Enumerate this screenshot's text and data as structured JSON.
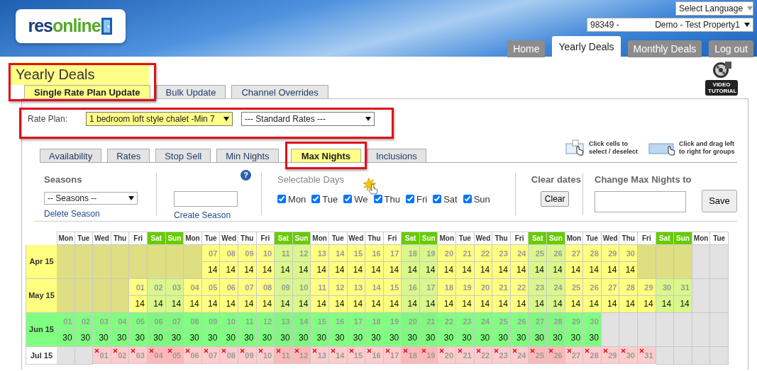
{
  "logo": {
    "parts": [
      {
        "text": "res",
        "color": "#1b3f7a"
      },
      {
        "text": "online",
        "color": "#56a92b"
      }
    ]
  },
  "language_select": "Select Language",
  "property_select": {
    "code": "98349 -",
    "name": "Demo - Test Property1"
  },
  "nav": [
    {
      "label": "Home",
      "selected": false
    },
    {
      "label": "Yearly Deals",
      "selected": true
    },
    {
      "label": "Monthly Deals",
      "selected": false
    },
    {
      "label": "Log out",
      "selected": false
    }
  ],
  "page_title": {
    "text": "Yearly Deals",
    "highlighted": true
  },
  "video_tutorial": "VIDEO TUTORIAL",
  "subtabs": [
    {
      "label": "Single Rate Plan Update",
      "selected": true,
      "highlighted": true
    },
    {
      "label": "Bulk Update",
      "selected": false,
      "highlighted": false
    },
    {
      "label": "Channel Overrides",
      "selected": false,
      "highlighted": false
    }
  ],
  "rate_plan": {
    "label": "Rate Plan:",
    "highlighted": true,
    "selects": [
      {
        "value": "1 bedroom loft style chalet -Min 7",
        "highlighted": true
      },
      {
        "value": "--- Standard Rates ---",
        "highlighted": false
      }
    ]
  },
  "hints": [
    "Click cells to select / deselect",
    "Click and drag left to right for groups"
  ],
  "tabs": [
    {
      "label": "Availability",
      "selected": false,
      "highlighted": false
    },
    {
      "label": "Rates",
      "selected": false,
      "highlighted": false
    },
    {
      "label": "Stop Sell",
      "selected": false,
      "highlighted": false
    },
    {
      "label": "Min Nights",
      "selected": false,
      "highlighted": false
    },
    {
      "label": "Max Nights",
      "selected": true,
      "highlighted": true
    },
    {
      "label": "Inclusions",
      "selected": false,
      "highlighted": false
    }
  ],
  "seasons": {
    "heading": "Seasons",
    "help": "?",
    "select": "-- Seasons --",
    "delete_link": "Delete Season",
    "create_link": "Create Season"
  },
  "selectable_days": {
    "heading": "Selectable Days",
    "days": [
      {
        "label": "Mon",
        "checked": true
      },
      {
        "label": "Tue",
        "checked": true
      },
      {
        "label": "We",
        "checked": true
      },
      {
        "label": "Thu",
        "checked": true
      },
      {
        "label": "Fri",
        "checked": true
      },
      {
        "label": "Sat",
        "checked": true
      },
      {
        "label": "Sun",
        "checked": true
      }
    ]
  },
  "clear_dates": {
    "heading": "Clear dates",
    "button": "Clear"
  },
  "change_max": {
    "heading": "Change Max Nights to",
    "button": "Save"
  },
  "calendar": {
    "columns": [
      {
        "label": "Mon",
        "weekend": false
      },
      {
        "label": "Tue",
        "weekend": false
      },
      {
        "label": "Wed",
        "weekend": false
      },
      {
        "label": "Thu",
        "weekend": false
      },
      {
        "label": "Fri",
        "weekend": false
      },
      {
        "label": "Sat",
        "weekend": true
      },
      {
        "label": "Sun",
        "weekend": true
      },
      {
        "label": "Mon",
        "weekend": false
      },
      {
        "label": "Tue",
        "weekend": false
      },
      {
        "label": "Wed",
        "weekend": false
      },
      {
        "label": "Thu",
        "weekend": false
      },
      {
        "label": "Fri",
        "weekend": false
      },
      {
        "label": "Sat",
        "weekend": true
      },
      {
        "label": "Sun",
        "weekend": true
      },
      {
        "label": "Mon",
        "weekend": false
      },
      {
        "label": "Tue",
        "weekend": false
      },
      {
        "label": "Wed",
        "weekend": false
      },
      {
        "label": "Thu",
        "weekend": false
      },
      {
        "label": "Fri",
        "weekend": false
      },
      {
        "label": "Sat",
        "weekend": true
      },
      {
        "label": "Sun",
        "weekend": true
      },
      {
        "label": "Mon",
        "weekend": false
      },
      {
        "label": "Tue",
        "weekend": false
      },
      {
        "label": "Wed",
        "weekend": false
      },
      {
        "label": "Thu",
        "weekend": false
      },
      {
        "label": "Fri",
        "weekend": false
      },
      {
        "label": "Sat",
        "weekend": true
      },
      {
        "label": "Sun",
        "weekend": true
      },
      {
        "label": "Mon",
        "weekend": false
      },
      {
        "label": "Tue",
        "weekend": false
      },
      {
        "label": "Wed",
        "weekend": false
      },
      {
        "label": "Thu",
        "weekend": false
      },
      {
        "label": "Fri",
        "weekend": false
      },
      {
        "label": "Sat",
        "weekend": true
      },
      {
        "label": "Sun",
        "weekend": true
      },
      {
        "label": "Mon",
        "weekend": false
      },
      {
        "label": "Tue",
        "weekend": false
      }
    ],
    "months": [
      {
        "label": "Apr 15",
        "kind": "open",
        "cells": [
          {
            "kind": "past"
          },
          {
            "kind": "past"
          },
          {
            "kind": "past"
          },
          {
            "kind": "past"
          },
          {
            "kind": "past"
          },
          {
            "kind": "past"
          },
          {
            "kind": "past"
          },
          {
            "kind": "past"
          },
          {
            "kind": "day",
            "date": "07",
            "nights": "14"
          },
          {
            "kind": "day",
            "date": "08",
            "nights": "14"
          },
          {
            "kind": "day",
            "date": "09",
            "nights": "14"
          },
          {
            "kind": "day",
            "date": "10",
            "nights": "14"
          },
          {
            "kind": "day",
            "date": "11",
            "nights": "14"
          },
          {
            "kind": "day",
            "date": "12",
            "nights": "14"
          },
          {
            "kind": "day",
            "date": "13",
            "nights": "14"
          },
          {
            "kind": "day",
            "date": "14",
            "nights": "14"
          },
          {
            "kind": "day",
            "date": "15",
            "nights": "14"
          },
          {
            "kind": "day",
            "date": "16",
            "nights": "14"
          },
          {
            "kind": "day",
            "date": "17",
            "nights": "14"
          },
          {
            "kind": "day",
            "date": "18",
            "nights": "14"
          },
          {
            "kind": "day",
            "date": "19",
            "nights": "14"
          },
          {
            "kind": "day",
            "date": "20",
            "nights": "14"
          },
          {
            "kind": "day",
            "date": "21",
            "nights": "14"
          },
          {
            "kind": "day",
            "date": "22",
            "nights": "14"
          },
          {
            "kind": "day",
            "date": "23",
            "nights": "14"
          },
          {
            "kind": "day",
            "date": "24",
            "nights": "14"
          },
          {
            "kind": "day",
            "date": "25",
            "nights": "14"
          },
          {
            "kind": "day",
            "date": "26",
            "nights": "14"
          },
          {
            "kind": "day",
            "date": "27",
            "nights": "14"
          },
          {
            "kind": "day",
            "date": "28",
            "nights": "14"
          },
          {
            "kind": "day",
            "date": "29",
            "nights": "14"
          },
          {
            "kind": "day",
            "date": "30",
            "nights": "14"
          },
          {
            "kind": "past"
          },
          {
            "kind": "past"
          },
          {
            "kind": "past"
          },
          {
            "kind": "none"
          },
          {
            "kind": "none"
          }
        ]
      },
      {
        "label": "May 15",
        "kind": "open",
        "cells": [
          {
            "kind": "past"
          },
          {
            "kind": "past"
          },
          {
            "kind": "past"
          },
          {
            "kind": "past"
          },
          {
            "kind": "day",
            "date": "01",
            "nights": "14"
          },
          {
            "kind": "day",
            "date": "02",
            "nights": "14"
          },
          {
            "kind": "day",
            "date": "03",
            "nights": "14"
          },
          {
            "kind": "day",
            "date": "04",
            "nights": "14"
          },
          {
            "kind": "day",
            "date": "05",
            "nights": "14"
          },
          {
            "kind": "day",
            "date": "06",
            "nights": "14"
          },
          {
            "kind": "day",
            "date": "07",
            "nights": "14"
          },
          {
            "kind": "day",
            "date": "08",
            "nights": "14"
          },
          {
            "kind": "day",
            "date": "09",
            "nights": "14"
          },
          {
            "kind": "day",
            "date": "10",
            "nights": "14"
          },
          {
            "kind": "day",
            "date": "11",
            "nights": "14"
          },
          {
            "kind": "day",
            "date": "12",
            "nights": "14"
          },
          {
            "kind": "day",
            "date": "13",
            "nights": "14"
          },
          {
            "kind": "day",
            "date": "14",
            "nights": "14"
          },
          {
            "kind": "day",
            "date": "15",
            "nights": "14"
          },
          {
            "kind": "day",
            "date": "16",
            "nights": "14"
          },
          {
            "kind": "day",
            "date": "17",
            "nights": "14"
          },
          {
            "kind": "day",
            "date": "18",
            "nights": "14"
          },
          {
            "kind": "day",
            "date": "19",
            "nights": "14"
          },
          {
            "kind": "day",
            "date": "20",
            "nights": "14"
          },
          {
            "kind": "day",
            "date": "21",
            "nights": "14"
          },
          {
            "kind": "day",
            "date": "22",
            "nights": "14"
          },
          {
            "kind": "day",
            "date": "23",
            "nights": "14"
          },
          {
            "kind": "day",
            "date": "24",
            "nights": "14"
          },
          {
            "kind": "day",
            "date": "25",
            "nights": "14"
          },
          {
            "kind": "day",
            "date": "26",
            "nights": "14"
          },
          {
            "kind": "day",
            "date": "27",
            "nights": "14"
          },
          {
            "kind": "day",
            "date": "28",
            "nights": "14"
          },
          {
            "kind": "day",
            "date": "29",
            "nights": "14"
          },
          {
            "kind": "day",
            "date": "30",
            "nights": "14"
          },
          {
            "kind": "day",
            "date": "31",
            "nights": "14"
          },
          {
            "kind": "none"
          },
          {
            "kind": "none"
          }
        ]
      },
      {
        "label": "Jun 15",
        "kind": "selected",
        "cells": [
          {
            "kind": "day",
            "date": "01",
            "nights": "30"
          },
          {
            "kind": "day",
            "date": "02",
            "nights": "30"
          },
          {
            "kind": "day",
            "date": "03",
            "nights": "30"
          },
          {
            "kind": "day",
            "date": "04",
            "nights": "30"
          },
          {
            "kind": "day",
            "date": "05",
            "nights": "30"
          },
          {
            "kind": "day",
            "date": "06",
            "nights": "30"
          },
          {
            "kind": "day",
            "date": "07",
            "nights": "30"
          },
          {
            "kind": "day",
            "date": "08",
            "nights": "30"
          },
          {
            "kind": "day",
            "date": "09",
            "nights": "30"
          },
          {
            "kind": "day",
            "date": "10",
            "nights": "30"
          },
          {
            "kind": "day",
            "date": "11",
            "nights": "30"
          },
          {
            "kind": "day",
            "date": "12",
            "nights": "30"
          },
          {
            "kind": "day",
            "date": "13",
            "nights": "30"
          },
          {
            "kind": "day",
            "date": "14",
            "nights": "30"
          },
          {
            "kind": "day",
            "date": "15",
            "nights": "30"
          },
          {
            "kind": "day",
            "date": "16",
            "nights": "30"
          },
          {
            "kind": "day",
            "date": "17",
            "nights": "30"
          },
          {
            "kind": "day",
            "date": "18",
            "nights": "30"
          },
          {
            "kind": "day",
            "date": "19",
            "nights": "30"
          },
          {
            "kind": "day",
            "date": "20",
            "nights": "30"
          },
          {
            "kind": "day",
            "date": "21",
            "nights": "30"
          },
          {
            "kind": "day",
            "date": "22",
            "nights": "30"
          },
          {
            "kind": "day",
            "date": "23",
            "nights": "30"
          },
          {
            "kind": "day",
            "date": "24",
            "nights": "30"
          },
          {
            "kind": "day",
            "date": "25",
            "nights": "30"
          },
          {
            "kind": "day",
            "date": "26",
            "nights": "30"
          },
          {
            "kind": "day",
            "date": "27",
            "nights": "30"
          },
          {
            "kind": "day",
            "date": "28",
            "nights": "30"
          },
          {
            "kind": "day",
            "date": "29",
            "nights": "30"
          },
          {
            "kind": "day",
            "date": "30",
            "nights": "30"
          },
          {
            "kind": "none"
          },
          {
            "kind": "none"
          },
          {
            "kind": "none"
          },
          {
            "kind": "none"
          },
          {
            "kind": "none"
          },
          {
            "kind": "none"
          },
          {
            "kind": "none"
          }
        ]
      },
      {
        "label": "Jul 15",
        "kind": "closed",
        "cells": [
          {
            "kind": "none"
          },
          {
            "kind": "none"
          },
          {
            "kind": "day",
            "date": "01"
          },
          {
            "kind": "day",
            "date": "02"
          },
          {
            "kind": "day",
            "date": "03"
          },
          {
            "kind": "day",
            "date": "04"
          },
          {
            "kind": "day",
            "date": "05"
          },
          {
            "kind": "day",
            "date": "06"
          },
          {
            "kind": "day",
            "date": "07"
          },
          {
            "kind": "day",
            "date": "08"
          },
          {
            "kind": "day",
            "date": "09"
          },
          {
            "kind": "day",
            "date": "10"
          },
          {
            "kind": "day",
            "date": "11"
          },
          {
            "kind": "day",
            "date": "12"
          },
          {
            "kind": "day",
            "date": "13"
          },
          {
            "kind": "day",
            "date": "14"
          },
          {
            "kind": "day",
            "date": "15"
          },
          {
            "kind": "day",
            "date": "16"
          },
          {
            "kind": "day",
            "date": "17"
          },
          {
            "kind": "day",
            "date": "18"
          },
          {
            "kind": "day",
            "date": "19"
          },
          {
            "kind": "day",
            "date": "20"
          },
          {
            "kind": "day",
            "date": "21"
          },
          {
            "kind": "day",
            "date": "22"
          },
          {
            "kind": "day",
            "date": "23"
          },
          {
            "kind": "day",
            "date": "24"
          },
          {
            "kind": "day",
            "date": "25"
          },
          {
            "kind": "day",
            "date": "26"
          },
          {
            "kind": "day",
            "date": "27"
          },
          {
            "kind": "day",
            "date": "28"
          },
          {
            "kind": "day",
            "date": "29"
          },
          {
            "kind": "day",
            "date": "30"
          },
          {
            "kind": "day",
            "date": "31"
          },
          {
            "kind": "none"
          },
          {
            "kind": "none"
          },
          {
            "kind": "none"
          },
          {
            "kind": "none"
          }
        ]
      }
    ]
  }
}
